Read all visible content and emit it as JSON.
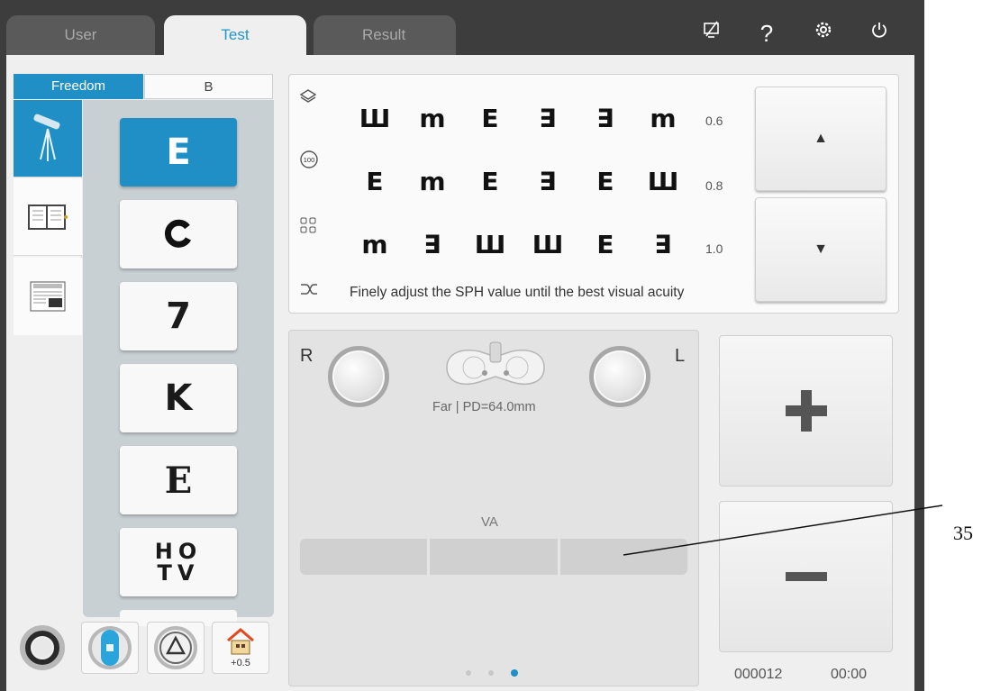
{
  "tabs": [
    {
      "label": "User"
    },
    {
      "label": "Test"
    },
    {
      "label": "Result"
    }
  ],
  "top_icons": [
    "screen-off-icon",
    "help-icon",
    "settings-icon",
    "power-icon"
  ],
  "mode_tabs": [
    "Freedom",
    "B"
  ],
  "side_icons": [
    "telescope-icon",
    "reading-book-icon",
    "newspaper-icon"
  ],
  "chart_options": [
    "E",
    "C",
    "7",
    "K",
    "E",
    "HO\nTV"
  ],
  "chart_options_display": {
    "ho_top": "HO",
    "ho_bottom": "TV"
  },
  "chart": {
    "rows": [
      {
        "symbols": [
          "Ш",
          "m",
          "E",
          "∃",
          "∃",
          "m"
        ],
        "acuity": "0.6"
      },
      {
        "symbols": [
          "E",
          "m",
          "E",
          "∃",
          "E",
          "Ш"
        ],
        "acuity": "0.8"
      },
      {
        "symbols": [
          "m",
          "∃",
          "Ш",
          "Ш",
          "E",
          "∃"
        ],
        "acuity": "1.0"
      }
    ],
    "icon_100": "100",
    "hint": "Finely adjust the SPH value until the best visual acuity"
  },
  "nav": {
    "up": "▲",
    "down": "▼"
  },
  "lens": {
    "right_label": "R",
    "left_label": "L",
    "pd": "Far | PD=64.0mm",
    "va_label": "VA"
  },
  "bottom_tools": [
    {
      "name": "ring-icon",
      "label": ""
    },
    {
      "name": "cylinder-lens-icon",
      "label": ""
    },
    {
      "name": "triangle-icon",
      "label": ""
    },
    {
      "name": "house-icon",
      "label": "+0.5"
    }
  ],
  "adjust": {
    "plus": "+",
    "minus": "−"
  },
  "status": {
    "counter": "000012",
    "time": "00:00"
  },
  "callout": "35",
  "colors": {
    "accent": "#1f8fc6",
    "dark": "#3d3d3d",
    "panel": "#efefef"
  }
}
